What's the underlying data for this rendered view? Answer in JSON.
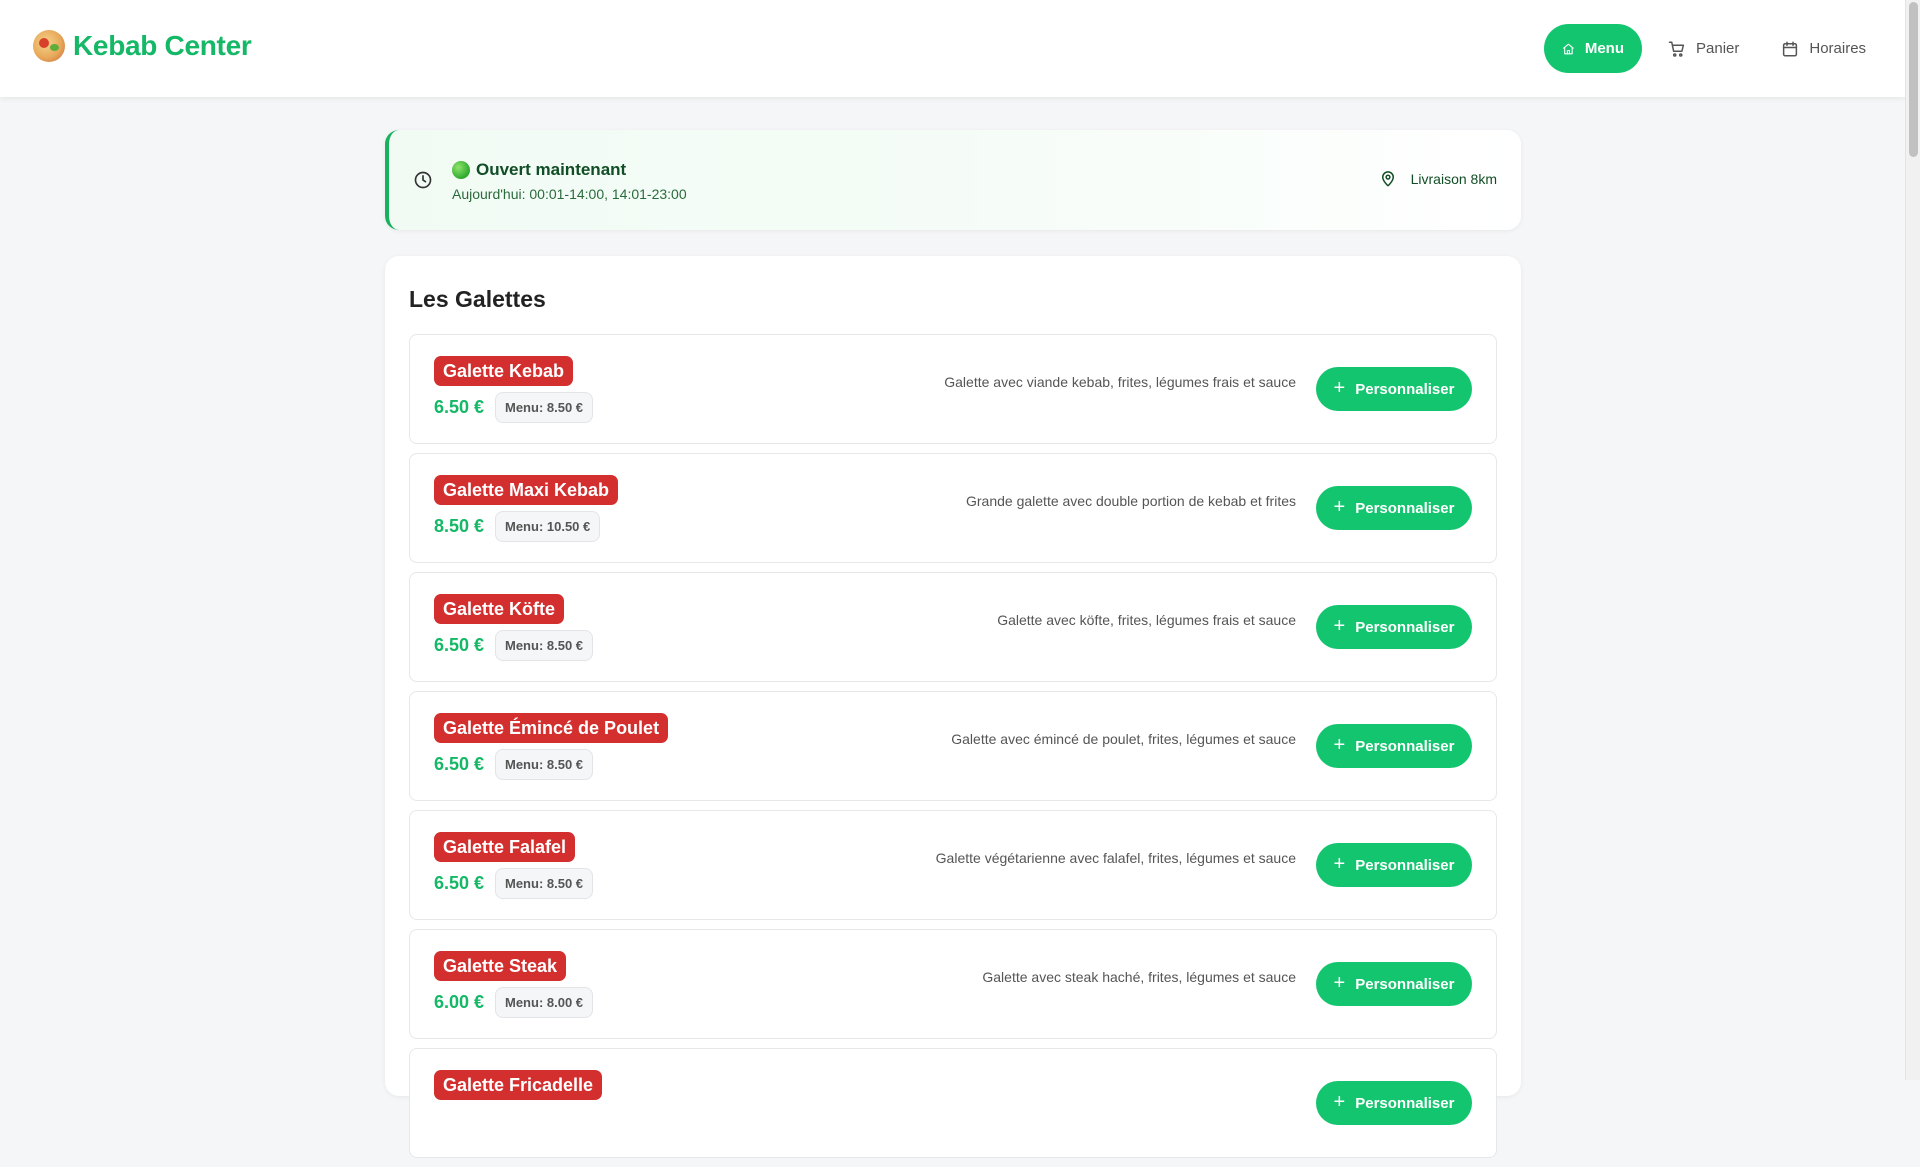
{
  "brand": {
    "name": "Kebab Center",
    "logo_icon": "kebab-logo-icon"
  },
  "nav": {
    "items": [
      {
        "label": "Menu",
        "icon": "home-icon",
        "active": true
      },
      {
        "label": "Panier",
        "icon": "cart-icon",
        "active": false
      },
      {
        "label": "Horaires",
        "icon": "calendar-icon",
        "active": false
      }
    ]
  },
  "status": {
    "title": "Ouvert maintenant",
    "hours": "Aujourd'hui: 00:01-14:00, 14:01-23:00",
    "delivery": "Livraison 8km",
    "accent_color": "#18b15e"
  },
  "section": {
    "title": "Les Galettes"
  },
  "items": [
    {
      "name": "Galette Kebab",
      "price": "6.50 €",
      "menu_price": "Menu: 8.50 €",
      "description": "Galette avec viande kebab, frites, légumes frais et sauce",
      "button": "Personnaliser"
    },
    {
      "name": "Galette Maxi Kebab",
      "price": "8.50 €",
      "menu_price": "Menu: 10.50 €",
      "description": "Grande galette avec double portion de kebab et frites",
      "button": "Personnaliser"
    },
    {
      "name": "Galette Köfte",
      "price": "6.50 €",
      "menu_price": "Menu: 8.50 €",
      "description": "Galette avec köfte, frites, légumes frais et sauce",
      "button": "Personnaliser"
    },
    {
      "name": "Galette Émincé de Poulet",
      "price": "6.50 €",
      "menu_price": "Menu: 8.50 €",
      "description": "Galette avec émincé de poulet, frites, légumes et sauce",
      "button": "Personnaliser"
    },
    {
      "name": "Galette Falafel",
      "price": "6.50 €",
      "menu_price": "Menu: 8.50 €",
      "description": "Galette végétarienne avec falafel, frites, légumes et sauce",
      "button": "Personnaliser"
    },
    {
      "name": "Galette Steak",
      "price": "6.00 €",
      "menu_price": "Menu: 8.00 €",
      "description": "Galette avec steak haché, frites, légumes et sauce",
      "button": "Personnaliser"
    },
    {
      "name": "Galette Fricadelle",
      "price": "",
      "menu_price": "",
      "description": "",
      "button": "Personnaliser"
    }
  ],
  "colors": {
    "primary_green": "#14c56f",
    "brand_green": "#14b866",
    "item_red": "#d32f2f"
  }
}
